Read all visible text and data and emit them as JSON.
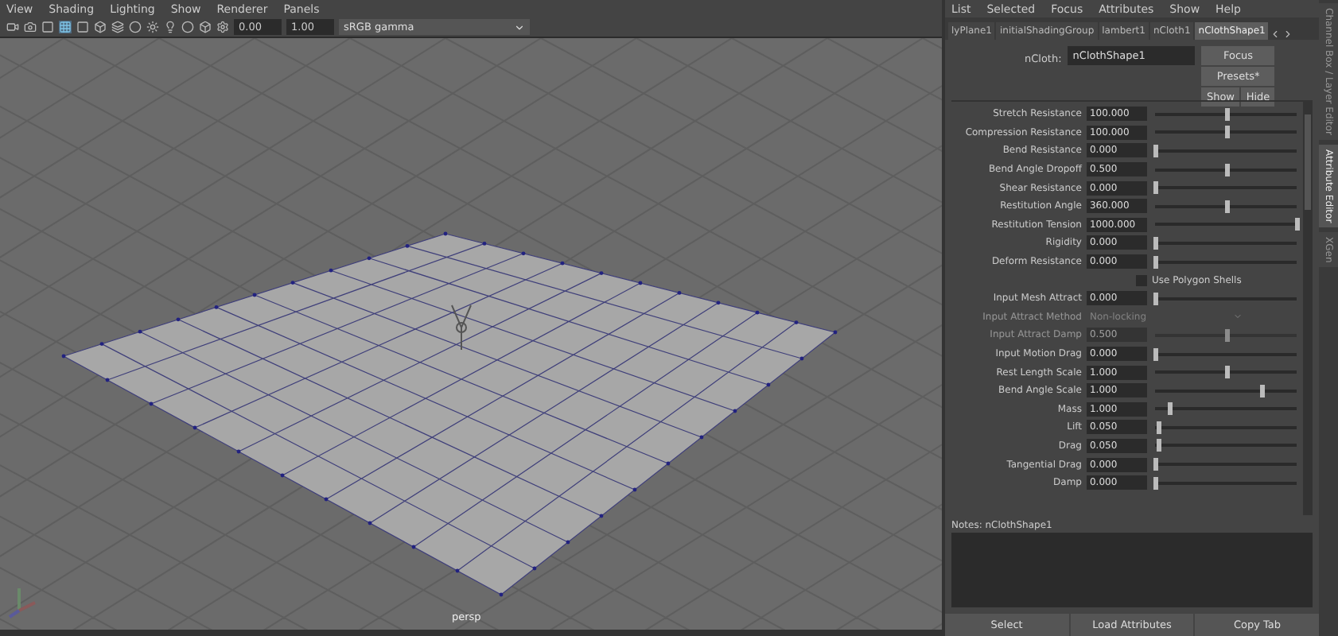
{
  "viewport": {
    "menu": [
      "View",
      "Shading",
      "Lighting",
      "Show",
      "Renderer",
      "Panels"
    ],
    "toolbar": {
      "exposure": "0.00",
      "gamma": "1.00",
      "color_space": "sRGB gamma"
    },
    "camera_label": "persp"
  },
  "attribute_editor": {
    "menu": [
      "List",
      "Selected",
      "Focus",
      "Attributes",
      "Show",
      "Help"
    ],
    "tabs": [
      {
        "label": "lyPlane1",
        "selected": false
      },
      {
        "label": "initialShadingGroup",
        "selected": false
      },
      {
        "label": "lambert1",
        "selected": false
      },
      {
        "label": "nCloth1",
        "selected": false
      },
      {
        "label": "nClothShape1",
        "selected": true
      }
    ],
    "node_label": "nCloth:",
    "node_name": "nClothShape1",
    "buttons": [
      "Focus",
      "Presets*",
      "Show",
      "Hide"
    ],
    "attributes": [
      {
        "kind": "slider",
        "label": "Stretch Resistance",
        "value": "100.000",
        "level": 0.5,
        "disabled": false
      },
      {
        "kind": "slider",
        "label": "Compression Resistance",
        "value": "100.000",
        "level": 0.5,
        "disabled": false
      },
      {
        "kind": "slider",
        "label": "Bend Resistance",
        "value": "0.000",
        "level": 0,
        "disabled": false
      },
      {
        "kind": "slider",
        "label": "Bend Angle Dropoff",
        "value": "0.500",
        "level": 0.5,
        "disabled": false
      },
      {
        "kind": "slider",
        "label": "Shear Resistance",
        "value": "0.000",
        "level": 0,
        "disabled": false
      },
      {
        "kind": "slider",
        "label": "Restitution Angle",
        "value": "360.000",
        "level": 0.5,
        "disabled": false
      },
      {
        "kind": "slider",
        "label": "Restitution Tension",
        "value": "1000.000",
        "level": 1,
        "disabled": false
      },
      {
        "kind": "slider",
        "label": "Rigidity",
        "value": "0.000",
        "level": 0,
        "disabled": false
      },
      {
        "kind": "slider",
        "label": "Deform Resistance",
        "value": "0.000",
        "level": 0,
        "disabled": false
      },
      {
        "kind": "checkbox",
        "label": "Use Polygon Shells",
        "checked": false,
        "disabled": false
      },
      {
        "kind": "slider",
        "label": "Input Mesh Attract",
        "value": "0.000",
        "level": 0,
        "disabled": false
      },
      {
        "kind": "dropdown",
        "label": "Input Attract Method",
        "value": "Non-locking",
        "disabled": true
      },
      {
        "kind": "slider",
        "label": "Input Attract Damp",
        "value": "0.500",
        "level": 0.5,
        "disabled": true
      },
      {
        "kind": "slider",
        "label": "Input Motion Drag",
        "value": "0.000",
        "level": 0,
        "disabled": false
      },
      {
        "kind": "slider",
        "label": "Rest Length Scale",
        "value": "1.000",
        "level": 0.5,
        "disabled": false
      },
      {
        "kind": "slider",
        "label": "Bend Angle Scale",
        "value": "1.000",
        "level": 0.75,
        "disabled": false
      },
      {
        "kind": "slider",
        "label": "Mass",
        "value": "1.000",
        "level": 0.1,
        "disabled": false
      },
      {
        "kind": "slider",
        "label": "Lift",
        "value": "0.050",
        "level": 0.02,
        "disabled": false
      },
      {
        "kind": "slider",
        "label": "Drag",
        "value": "0.050",
        "level": 0.02,
        "disabled": false
      },
      {
        "kind": "slider",
        "label": "Tangential Drag",
        "value": "0.000",
        "level": 0,
        "disabled": false
      },
      {
        "kind": "slider",
        "label": "Damp",
        "value": "0.000",
        "level": 0,
        "disabled": false
      }
    ],
    "notes_label": "Notes:  nClothShape1",
    "bottom_buttons": [
      "Select",
      "Load Attributes",
      "Copy Tab"
    ]
  },
  "side_tabs": [
    {
      "label": "Channel Box / Layer Editor",
      "selected": false
    },
    {
      "label": "Attribute Editor",
      "selected": true
    },
    {
      "label": "XGen",
      "selected": false
    }
  ]
}
